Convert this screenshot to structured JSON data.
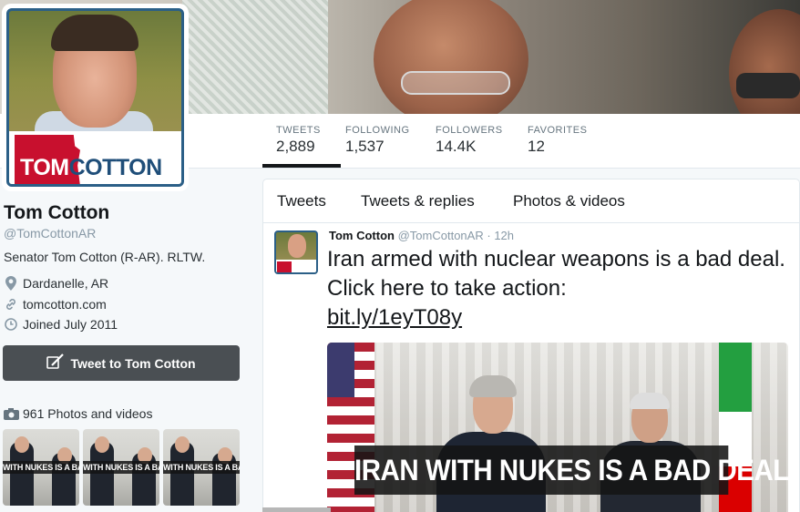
{
  "profile": {
    "name": "Tom Cotton",
    "handle": "@TomCottonAR",
    "bio": "Senator Tom Cotton (R-AR). RLTW.",
    "location": "Dardanelle, AR",
    "website": "tomcotton.com",
    "joined": "Joined July 2011",
    "logo_part1": "TOM",
    "logo_part2": "COTTON",
    "tweet_button": "Tweet to Tom Cotton",
    "photos_label": "961 Photos and videos",
    "thumb_caption": "WITH NUKES IS A BAD"
  },
  "stats": [
    {
      "label": "TWEETS",
      "value": "2,889"
    },
    {
      "label": "FOLLOWING",
      "value": "1,537"
    },
    {
      "label": "FOLLOWERS",
      "value": "14.4K"
    },
    {
      "label": "FAVORITES",
      "value": "12"
    }
  ],
  "tabs": [
    "Tweets",
    "Tweets & replies",
    "Photos & videos"
  ],
  "tweet": {
    "name": "Tom Cotton",
    "handle": "@TomCottonAR",
    "separator": "·",
    "time": "12h",
    "text": "Iran armed with nuclear weapons is a bad deal. Click here to take action:",
    "link": "bit.ly/1eyT08y",
    "media_caption": "IRAN WITH NUKES IS A BAD DEAL"
  },
  "icons": {
    "location": "map-pin-icon",
    "website": "link-icon",
    "joined": "calendar-icon",
    "tweet": "quill-icon",
    "photos": "camera-icon"
  },
  "colors": {
    "logo_red": "#c8102e",
    "logo_blue": "#1f4e79",
    "button_bg": "#4a4f53",
    "active_tab_underline": "#14171a"
  }
}
